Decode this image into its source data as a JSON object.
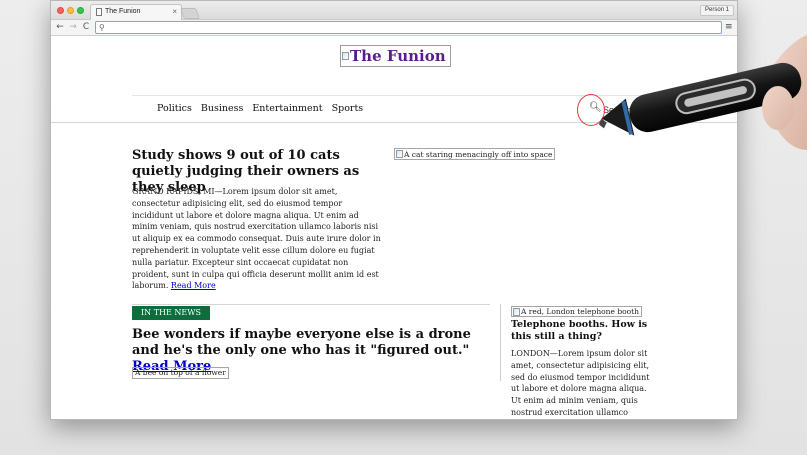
{
  "browser": {
    "tab_title": "The Funion",
    "tab_close": "×",
    "profile_label": "Person 1",
    "back_glyph": "←",
    "forward_glyph": "→",
    "reload_glyph": "C",
    "address_icon": "🔍",
    "menu_glyph": "≡",
    "address_value": ""
  },
  "site": {
    "logo_alt": "The Funion",
    "logo_color": "#5a1d8a",
    "nav": [
      "Politics",
      "Business",
      "Entertainment",
      "Sports"
    ],
    "search_icon": "search-icon",
    "search_label": "Search"
  },
  "feature": {
    "headline": "Study shows 9 out of 10 cats quietly judging their owners as they sleep",
    "body": "GRAND RAPIDS, MI—Lorem ipsum dolor sit amet, consectetur adipisicing elit, sed do eiusmod tempor incididunt ut labore et dolore magna aliqua. Ut enim ad minim veniam, quis nostrud exercitation ullamco laboris nisi ut aliquip ex ea commodo consequat. Duis aute irure dolor in reprehenderit in voluptate velit esse cillum dolore eu fugiat nulla pariatur. Excepteur sint occaecat cupidatat non proident, sunt in culpa qui officia deserunt mollit anim id est laborum.",
    "read_more": "Read More",
    "image_alt": "A cat staring menacingly off into space"
  },
  "in_the_news": {
    "label": "IN THE NEWS",
    "label_color": "#0f6c3c",
    "headline": "Bee wonders if maybe everyone else is a drone and he's the only one who has it \"figured out.\"",
    "read_more": "Read More",
    "image_alt": "A bee on top of a flower"
  },
  "sidebar_story": {
    "image_alt": "A red, London telephone booth",
    "headline": "Telephone booths. How is this still a thing?",
    "body": "LONDON—Lorem ipsum dolor sit amet, consectetur adipisicing elit, sed do eiusmod tempor incididunt ut labore et dolore magna aliqua. Ut enim ad minim veniam, quis nostrud exercitation ullamco laboris nisi ut aliquip ex ea commodo consequat."
  }
}
